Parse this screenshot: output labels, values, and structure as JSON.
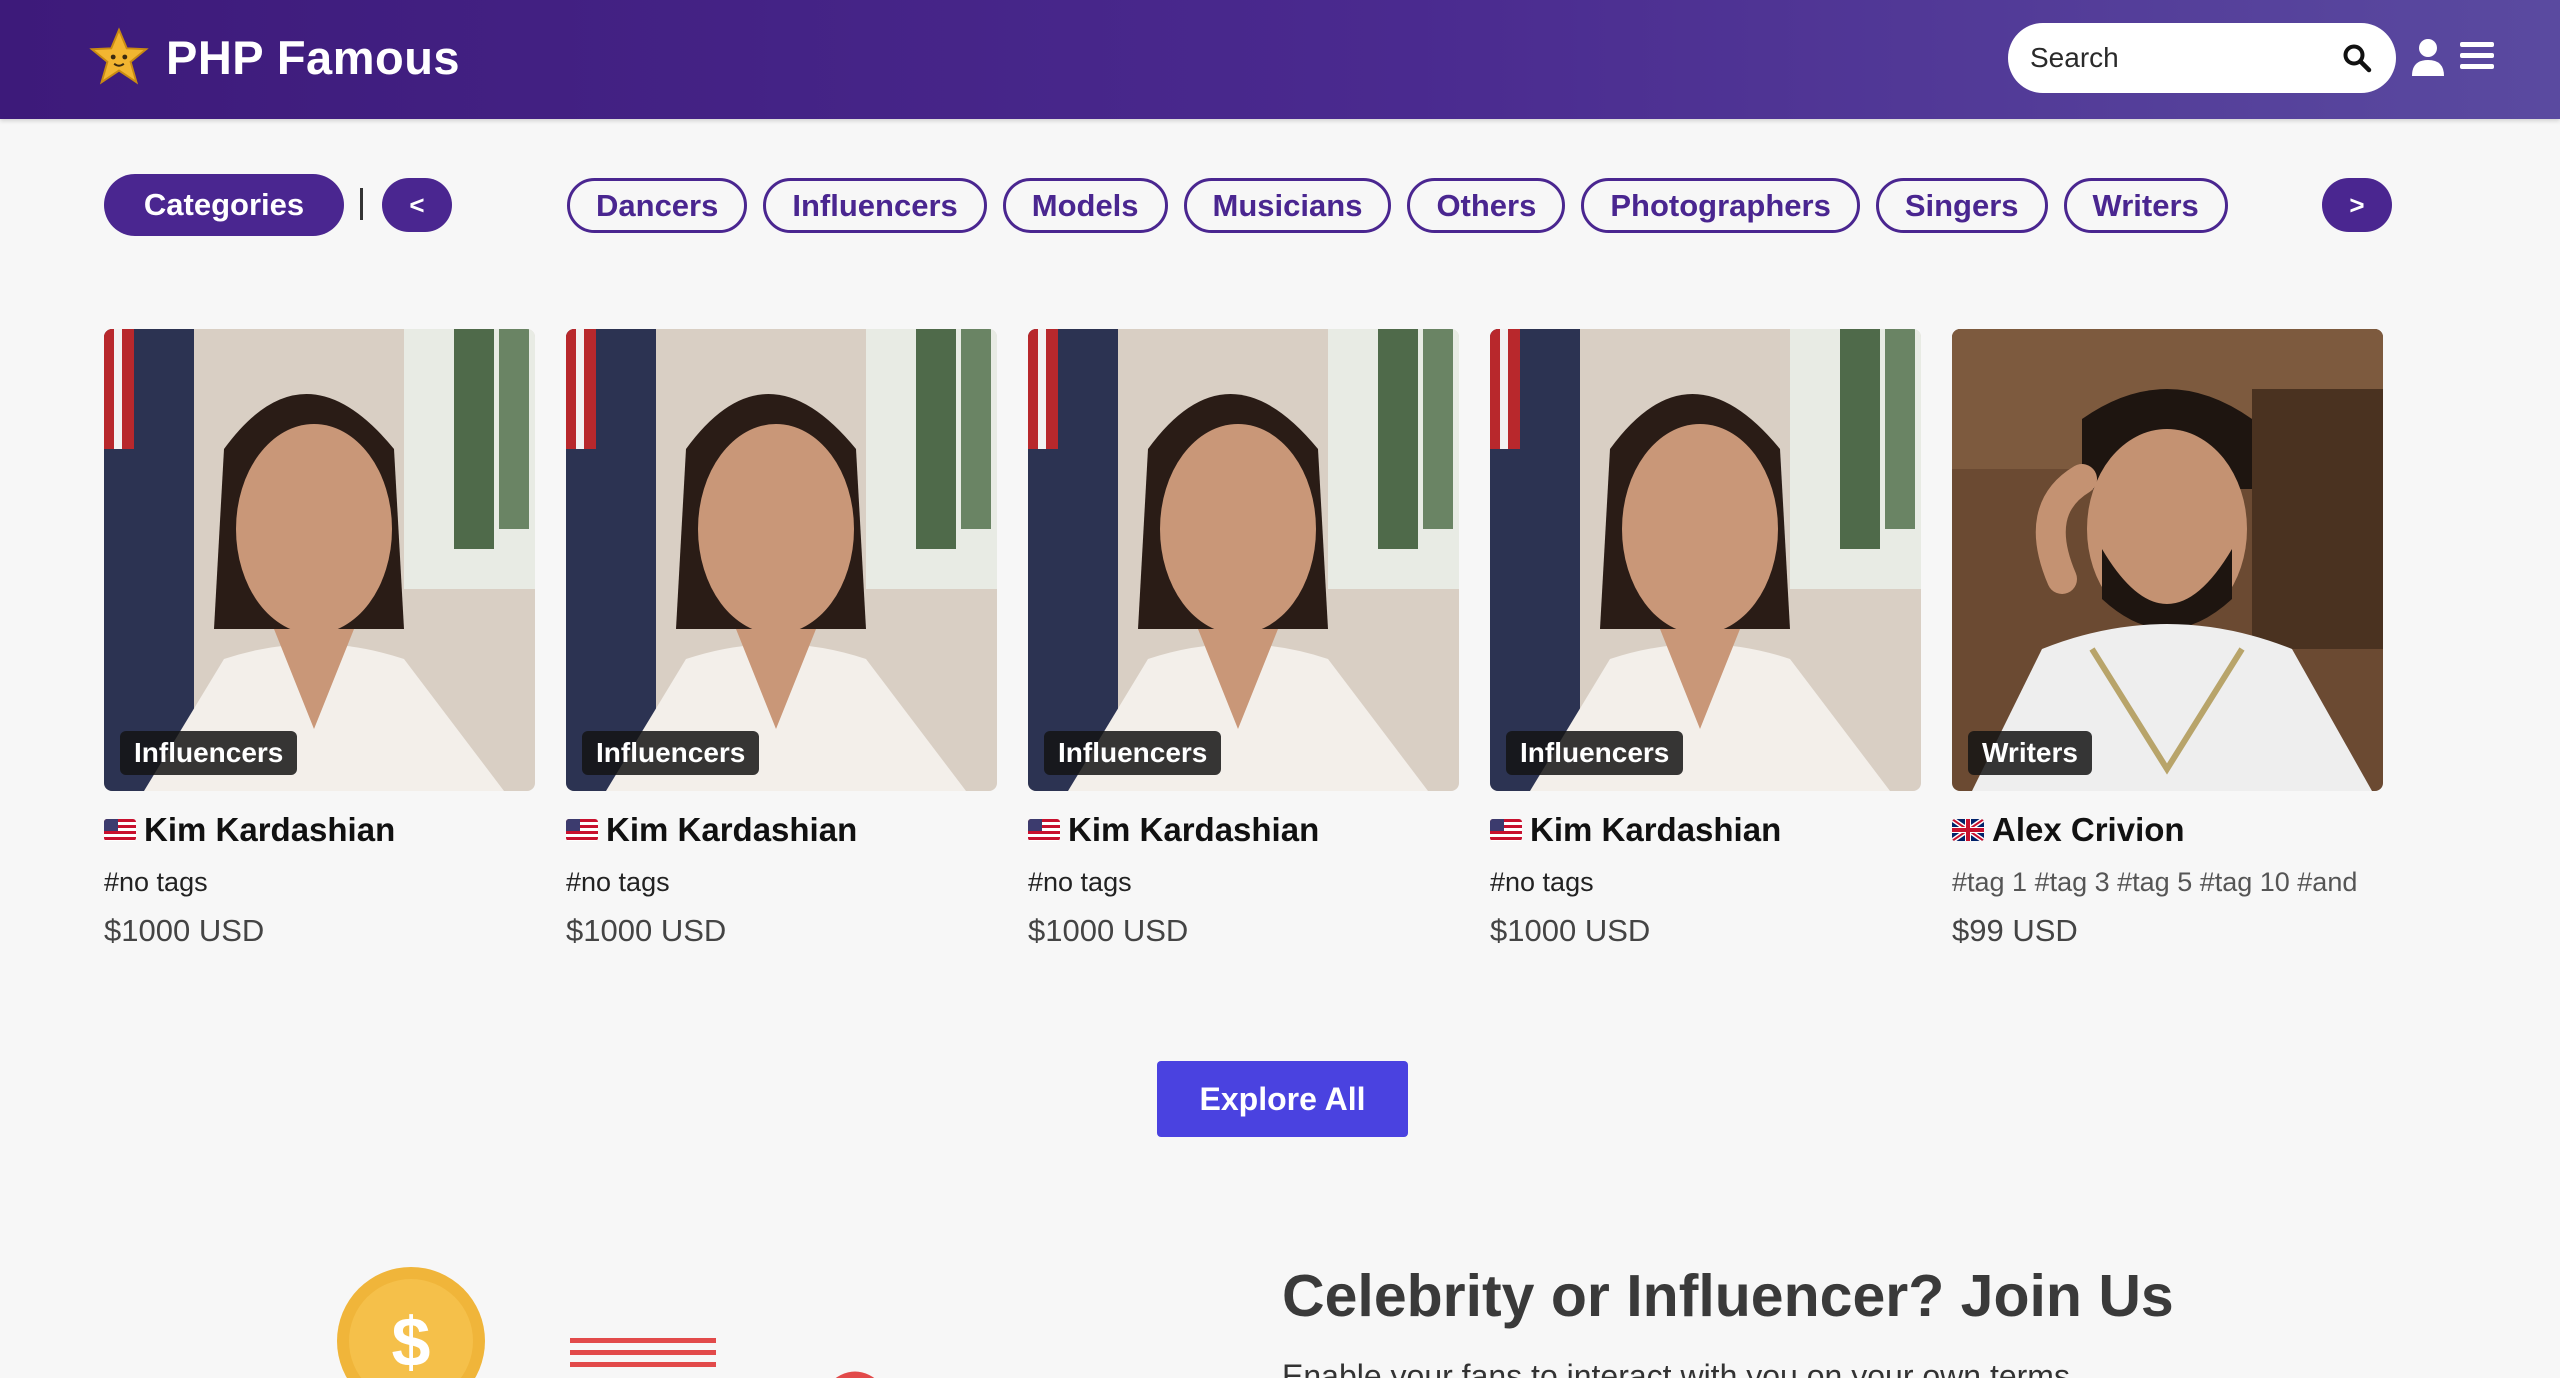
{
  "header": {
    "brand": "PHP Famous",
    "search_placeholder": "Search",
    "icons": [
      "star-logo-icon",
      "search-icon",
      "user-icon",
      "menu-icon"
    ]
  },
  "categories": {
    "button_label": "Categories",
    "prev_label": "<",
    "next_label": ">",
    "items": [
      "Dancers",
      "Influencers",
      "Models",
      "Musicians",
      "Others",
      "Photographers",
      "Singers",
      "Writers"
    ]
  },
  "cards": [
    {
      "category": "Influencers",
      "flag": "us-flag-icon",
      "name": "Kim Kardashian",
      "tags": "#no tags",
      "price": "$1000 USD"
    },
    {
      "category": "Influencers",
      "flag": "us-flag-icon",
      "name": "Kim Kardashian",
      "tags": "#no tags",
      "price": "$1000 USD"
    },
    {
      "category": "Influencers",
      "flag": "us-flag-icon",
      "name": "Kim Kardashian",
      "tags": "#no tags",
      "price": "$1000 USD"
    },
    {
      "category": "Influencers",
      "flag": "us-flag-icon",
      "name": "Kim Kardashian",
      "tags": "#no tags",
      "price": "$1000 USD"
    },
    {
      "category": "Writers",
      "flag": "uk-flag-icon",
      "name": "Alex Crivion",
      "tags": "#tag 1 #tag 3 #tag 5 #tag 10 #and",
      "price": "$99 USD"
    }
  ],
  "explore_label": "Explore All",
  "join": {
    "title": "Celebrity or Influencer? Join Us",
    "subtitle": "Enable your fans to interact with you on your own terms"
  },
  "colors": {
    "header_start": "#3d1a7a",
    "header_end": "#5a4aa0",
    "accent": "#4a2690",
    "explore": "#4a42e0",
    "background": "#f7f7f7"
  }
}
